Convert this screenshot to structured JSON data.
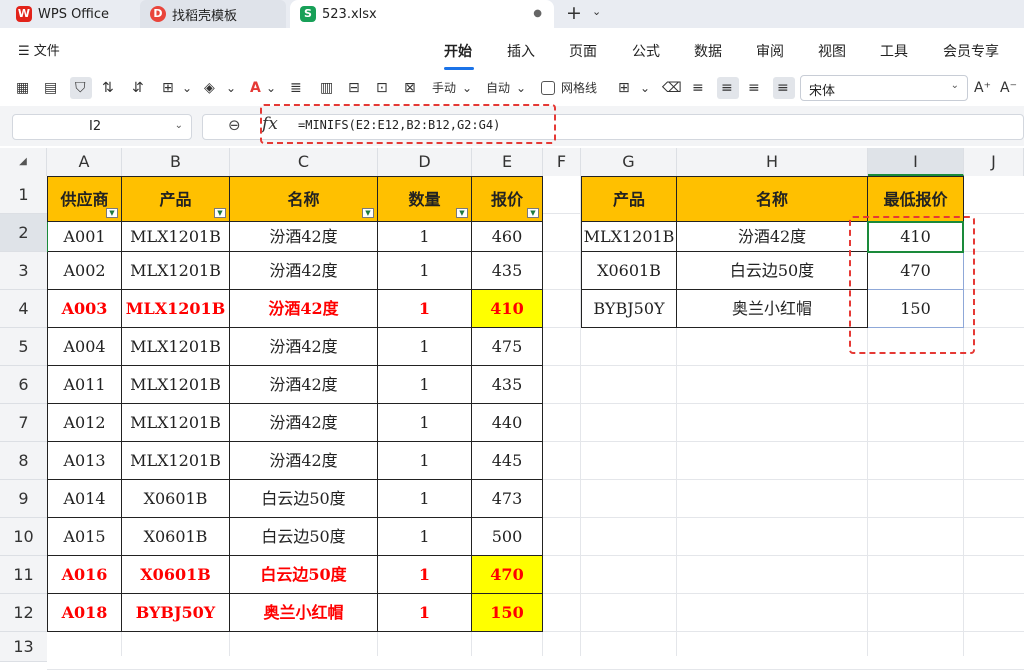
{
  "tabs": [
    {
      "label": "WPS Office"
    },
    {
      "label": "找稻壳模板"
    },
    {
      "label": "523.xlsx"
    }
  ],
  "menu": {
    "file": "文件",
    "items": [
      "开始",
      "插入",
      "页面",
      "公式",
      "数据",
      "审阅",
      "视图",
      "工具",
      "会员专享"
    ],
    "active": "开始"
  },
  "toolbar": {
    "manual": "手动",
    "auto": "自动",
    "gridlines": "网格线",
    "font": "宋体"
  },
  "namebox": "I2",
  "formula": "=MINIFS(E2:E12,B2:B12,G2:G4)",
  "columns": [
    "A",
    "B",
    "C",
    "D",
    "E",
    "F",
    "G",
    "H",
    "I",
    "J"
  ],
  "rows": [
    "1",
    "2",
    "3",
    "4",
    "5",
    "6",
    "7",
    "8",
    "9",
    "10",
    "11",
    "12",
    "13"
  ],
  "table1": {
    "headers": [
      "供应商",
      "产品",
      "名称",
      "数量",
      "报价"
    ],
    "rows": [
      [
        "A001",
        "MLX1201B",
        "汾酒42度",
        "1",
        "460"
      ],
      [
        "A002",
        "MLX1201B",
        "汾酒42度",
        "1",
        "435"
      ],
      [
        "A003",
        "MLX1201B",
        "汾酒42度",
        "1",
        "410"
      ],
      [
        "A004",
        "MLX1201B",
        "汾酒42度",
        "1",
        "475"
      ],
      [
        "A011",
        "MLX1201B",
        "汾酒42度",
        "1",
        "435"
      ],
      [
        "A012",
        "MLX1201B",
        "汾酒42度",
        "1",
        "440"
      ],
      [
        "A013",
        "MLX1201B",
        "汾酒42度",
        "1",
        "445"
      ],
      [
        "A014",
        "X0601B",
        "白云边50度",
        "1",
        "473"
      ],
      [
        "A015",
        "X0601B",
        "白云边50度",
        "1",
        "500"
      ],
      [
        "A016",
        "X0601B",
        "白云边50度",
        "1",
        "470"
      ],
      [
        "A018",
        "BYBJ50Y",
        "奥兰小红帽",
        "1",
        "150"
      ]
    ],
    "highlight_rows": [
      3,
      10,
      11
    ]
  },
  "table2": {
    "headers": [
      "产品",
      "名称",
      "最低报价"
    ],
    "rows": [
      [
        "MLX1201B",
        "汾酒42度",
        "410"
      ],
      [
        "X0601B",
        "白云边50度",
        "470"
      ],
      [
        "BYBJ50Y",
        "奥兰小红帽",
        "150"
      ]
    ]
  },
  "colors": {
    "header": "#ffc000",
    "highlight": "#ffff00",
    "red_text": "#ff0000",
    "selection": "#1a8a3a",
    "annotation": "#e53935"
  }
}
